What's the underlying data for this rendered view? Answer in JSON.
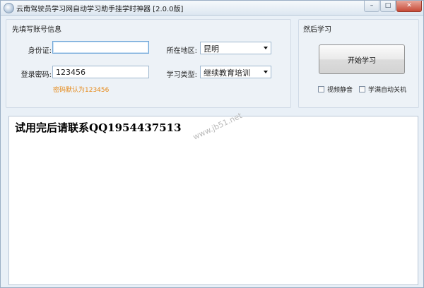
{
  "window": {
    "title": "云南驾驶员学习网自动学习助手挂学时神器 [2.0.0版]",
    "controls": {
      "minimize": "–",
      "maximize": "□",
      "close": "✕"
    },
    "icon": "app-globe-icon"
  },
  "account_group": {
    "title": "先填写账号信息",
    "id_label": "身份证:",
    "id_value": "",
    "password_label": "登录密码:",
    "password_value": "123456",
    "password_hint": "密码默认为123456",
    "region_label": "所在地区:",
    "region_value": "昆明",
    "type_label": "学习类型:",
    "type_value": "继续教育培训"
  },
  "learn_group": {
    "title": "然后学习",
    "start_button": "开始学习",
    "mute_label": "视频静音",
    "mute_checked": false,
    "shutdown_label": "学满自动关机",
    "shutdown_checked": false
  },
  "content": {
    "message": "试用完后请联系QQ1954437513",
    "watermark": "www.jb51.net"
  }
}
